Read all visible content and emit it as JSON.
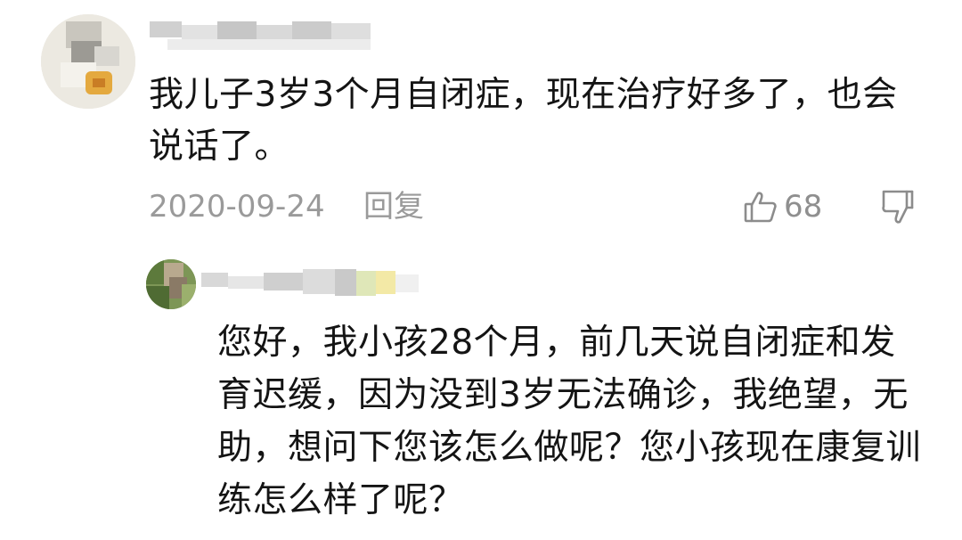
{
  "main_comment": {
    "text": "我儿子3岁3个月自闭症，现在治疗好多了，也会说话了。",
    "date": "2020-09-24",
    "reply_label": "回复",
    "likes": "68"
  },
  "reply_comment": {
    "text": "您好，我小孩28个月，前几天说自闭症和发育迟缓，因为没到3岁无法确诊，我绝望，无助，想问下您该怎么做呢？您小孩现在康复训练怎么样了呢？"
  },
  "icons": {
    "like": "thumbs-up-icon",
    "dislike": "thumbs-down-icon"
  },
  "colors": {
    "text": "#141414",
    "meta": "#9a9a9a"
  }
}
